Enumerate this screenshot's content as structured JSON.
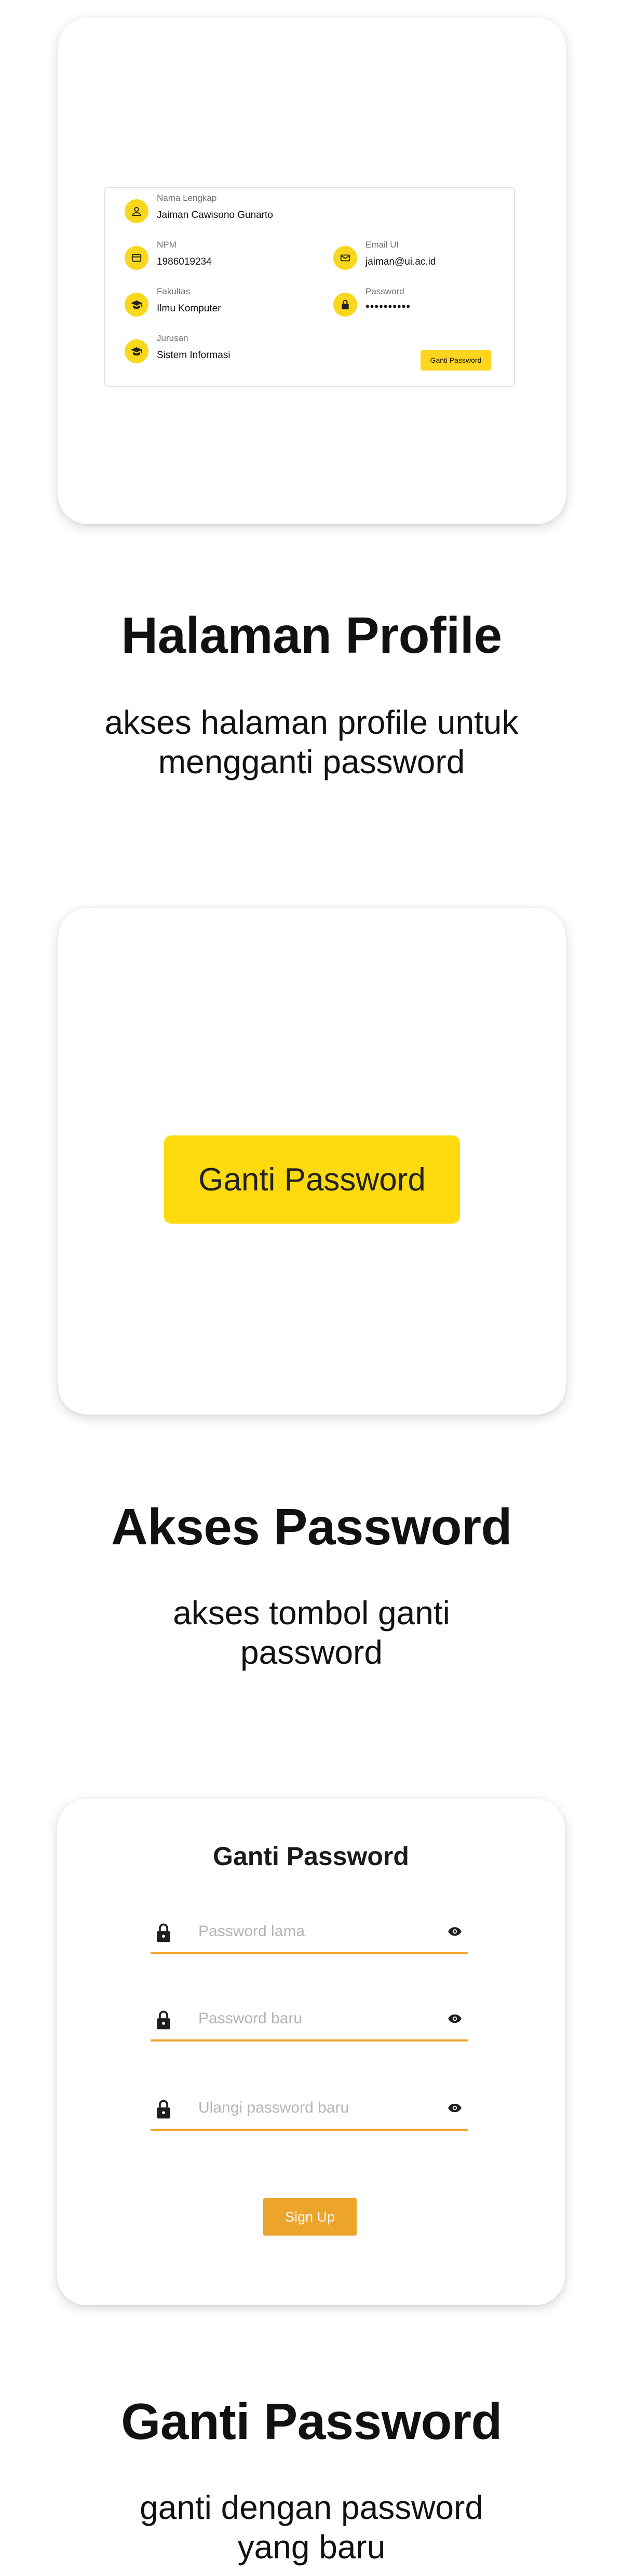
{
  "profile_card": {
    "fields": [
      {
        "icon": "user-icon",
        "label": "Nama Lengkap",
        "value": "Jaiman Cawisono Gunarto"
      },
      {
        "icon": "id-card-icon",
        "label": "NPM",
        "value": "1986019234"
      },
      {
        "icon": "email-icon",
        "label": "Email UI",
        "value": "jaiman@ui.ac.id"
      },
      {
        "icon": "graduation-cap-icon",
        "label": "Fakultas",
        "value": "Ilmu Komputer"
      },
      {
        "icon": "lock-icon",
        "label": "Password",
        "value": "••••••••••"
      },
      {
        "icon": "graduation-cap-icon",
        "label": "Jurusan",
        "value": "Sistem Informasi"
      }
    ],
    "button_label": "Ganti Password"
  },
  "section_1": {
    "title": "Halaman Profile",
    "caption_lines": [
      "akses halaman profile untuk",
      "mengganti password"
    ]
  },
  "button_card": {
    "button_label": "Ganti Password"
  },
  "section_2": {
    "title": "Akses Password",
    "caption_lines": [
      "akses tombol ganti",
      "password"
    ]
  },
  "form_card": {
    "title": "Ganti Password",
    "fields": [
      {
        "placeholder": "Password lama"
      },
      {
        "placeholder": "Password baru"
      },
      {
        "placeholder": "Ulangi password baru"
      }
    ],
    "submit_label": "Sign Up"
  },
  "section_3": {
    "title": "Ganti Password",
    "caption_lines": [
      "ganti dengan password",
      "yang baru"
    ]
  },
  "colors": {
    "accent_yellow": "#fdda0d",
    "submit_orange": "#eda42a",
    "underline_orange": "#f0a52a"
  }
}
